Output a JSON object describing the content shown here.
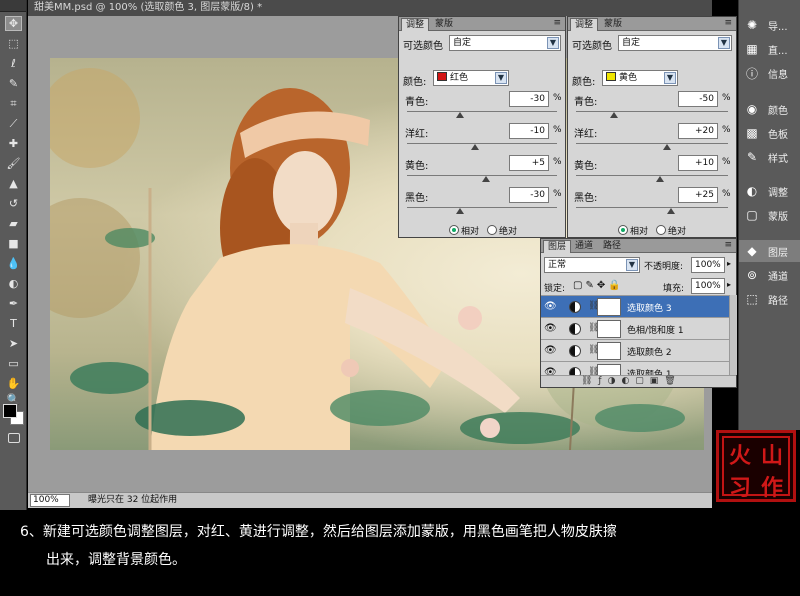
{
  "document": {
    "title": "甜美MM.psd @ 100% (选取颜色 3, 图层蒙版/8) *",
    "zoom": "100%",
    "status": "曝光只在 32 位起作用"
  },
  "adjust_red": {
    "tabs": [
      "调整",
      "蒙版"
    ],
    "panel_label": "可选颜色",
    "preset": "自定",
    "color_label": "颜色:",
    "color_value": "红色",
    "color_hex": "#d21414",
    "sliders": [
      {
        "label": "青色:",
        "value": "-30",
        "pos": -30
      },
      {
        "label": "洋红:",
        "value": "-10",
        "pos": -10
      },
      {
        "label": "黄色:",
        "value": "+5",
        "pos": 5
      },
      {
        "label": "黑色:",
        "value": "-30",
        "pos": -30
      }
    ],
    "percent": "%",
    "relative": "相对",
    "absolute": "绝对"
  },
  "adjust_yellow": {
    "tabs": [
      "调整",
      "蒙版"
    ],
    "panel_label": "可选颜色",
    "preset": "自定",
    "color_label": "颜色:",
    "color_value": "黄色",
    "color_hex": "#f0e600",
    "sliders": [
      {
        "label": "青色:",
        "value": "-50",
        "pos": -50
      },
      {
        "label": "洋红:",
        "value": "+20",
        "pos": 20
      },
      {
        "label": "黄色:",
        "value": "+10",
        "pos": 10
      },
      {
        "label": "黑色:",
        "value": "+25",
        "pos": 25
      }
    ],
    "percent": "%",
    "relative": "相对",
    "absolute": "绝对"
  },
  "layers": {
    "tabs": [
      "图层",
      "通道",
      "路径"
    ],
    "blend_mode": "正常",
    "opacity_label": "不透明度:",
    "opacity": "100%",
    "lock_label": "锁定:",
    "fill_label": "填充:",
    "fill": "100%",
    "rows": [
      {
        "name": "选取颜色 3",
        "selected": true
      },
      {
        "name": "色相/饱和度 1",
        "selected": false
      },
      {
        "name": "选取颜色 2",
        "selected": false
      },
      {
        "name": "选取颜色 1",
        "selected": false
      }
    ]
  },
  "dock": {
    "items": [
      "导...",
      "直...",
      "信息",
      "颜色",
      "色板",
      "样式",
      "调整",
      "蒙版",
      "图层",
      "通道",
      "路径"
    ],
    "icons": [
      "navigator-icon",
      "histogram-icon",
      "info-icon",
      "color-icon",
      "swatches-icon",
      "styles-icon",
      "adjustments-icon",
      "masks-icon",
      "layers-icon",
      "channels-icon",
      "paths-icon"
    ]
  },
  "seal": {
    "chars": [
      "火",
      "山",
      "习",
      "作"
    ]
  },
  "caption": {
    "line1": "6、新建可选颜色调整图层，对红、黄进行调整，然后给图层添加蒙版，用黑色画笔把人物皮肤擦",
    "line2": "出来，调整背景颜色。"
  }
}
